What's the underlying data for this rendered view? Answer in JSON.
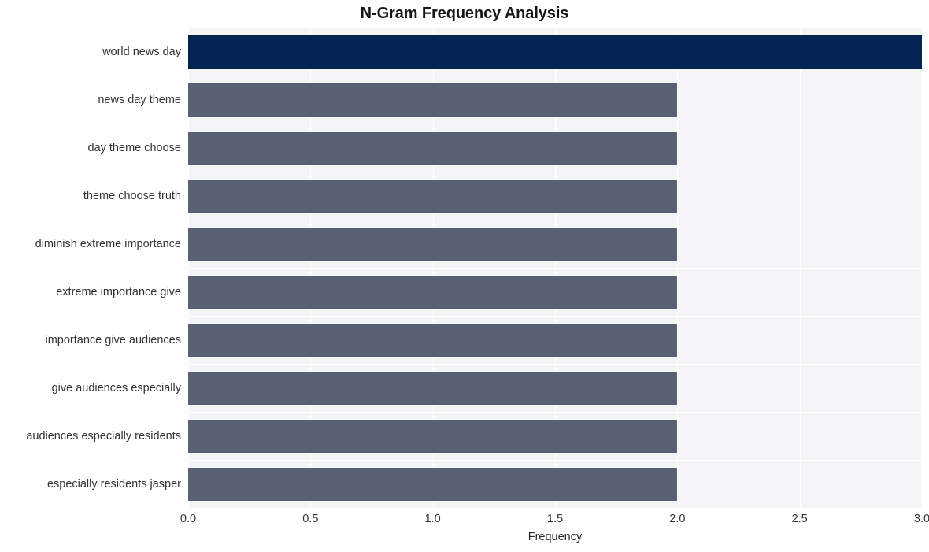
{
  "chart_data": {
    "type": "bar",
    "orientation": "horizontal",
    "title": "N-Gram Frequency Analysis",
    "xlabel": "Frequency",
    "ylabel": "",
    "categories": [
      "world news day",
      "news day theme",
      "day theme choose",
      "theme choose truth",
      "diminish extreme importance",
      "extreme importance give",
      "importance give audiences",
      "give audiences especially",
      "audiences especially residents",
      "especially residents jasper"
    ],
    "values": [
      3,
      2,
      2,
      2,
      2,
      2,
      2,
      2,
      2,
      2
    ],
    "bar_colors": [
      "#042453",
      "#5a6074",
      "#5a6074",
      "#5a6074",
      "#5a6074",
      "#5a6074",
      "#5a6074",
      "#5a6074",
      "#5a6074",
      "#5a6074"
    ],
    "xlim": [
      0.0,
      3.0
    ],
    "xticks": [
      0.0,
      0.5,
      1.0,
      1.5,
      2.0,
      2.5,
      3.0
    ],
    "xtick_labels": [
      "0.0",
      "0.5",
      "1.0",
      "1.5",
      "2.0",
      "2.5",
      "3.0"
    ],
    "grid": true,
    "grid_color": "#ffffff",
    "plot_background": "#f5f5f7",
    "figure_background": "#ffffff",
    "legend": null,
    "highlight_color": "#042453",
    "base_color": "#5a6074"
  }
}
